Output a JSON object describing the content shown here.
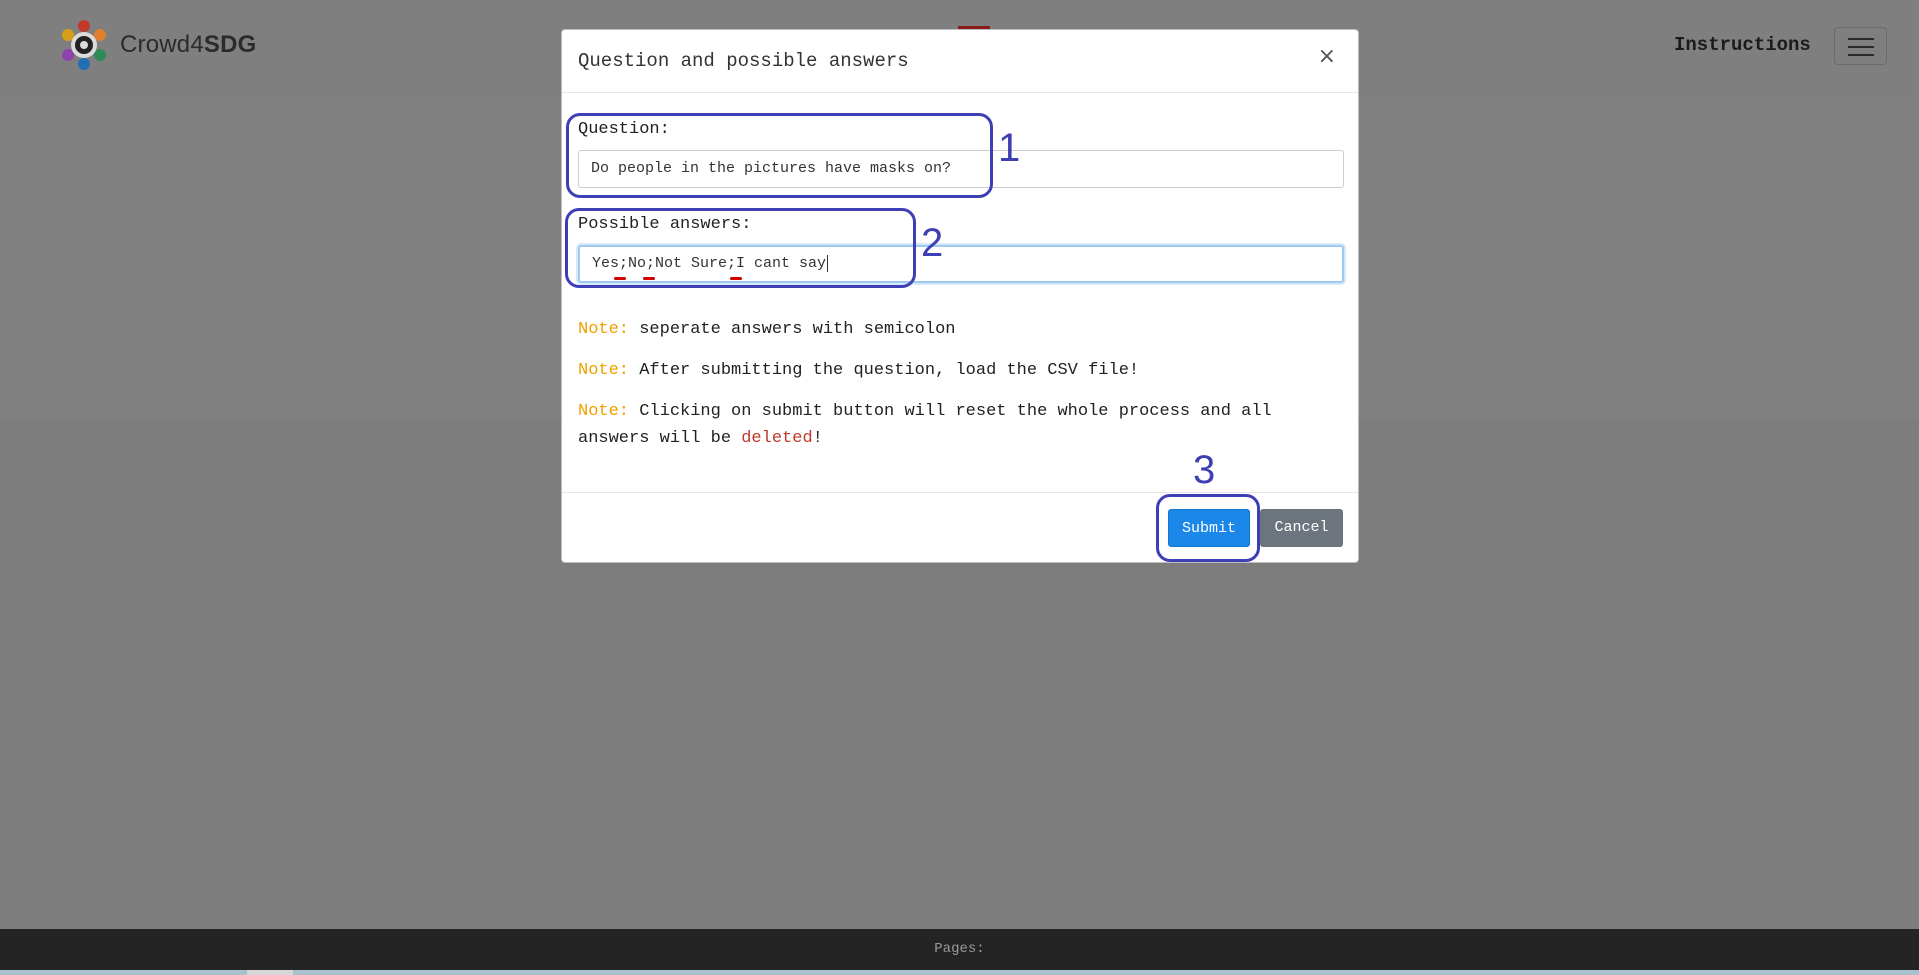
{
  "header": {
    "logo_text_regular": "Crowd4",
    "logo_text_bold": "SDG",
    "instructions_label": "Instructions"
  },
  "modal": {
    "title": "Question and possible answers",
    "close_label": "×",
    "question_label": "Question:",
    "question_value": "Do people in the pictures have masks on?",
    "answers_label": "Possible answers:",
    "answers_value": "Yes;No;Not Sure;I cant say",
    "notes": [
      {
        "label": "Note:",
        "text": " seperate answers with semicolon"
      },
      {
        "label": "Note:",
        "text": " After submitting the question, load the CSV file!"
      },
      {
        "label": "Note:",
        "text_before": " Clicking on submit button will reset the whole process and all answers will be ",
        "highlight": "deleted",
        "text_after": "!"
      }
    ],
    "submit_label": "Submit",
    "cancel_label": "Cancel"
  },
  "annotations": {
    "one": "1",
    "two": "2",
    "three": "3"
  },
  "footer": {
    "pages_label": "Pages:"
  },
  "colors": {
    "overlay": "#7f7f7f",
    "note_accent": "#f0a000",
    "submit": "#1b87e8",
    "cancel": "#6c757d",
    "annotation": "#3f3fb5",
    "deleted": "#c0392b"
  }
}
